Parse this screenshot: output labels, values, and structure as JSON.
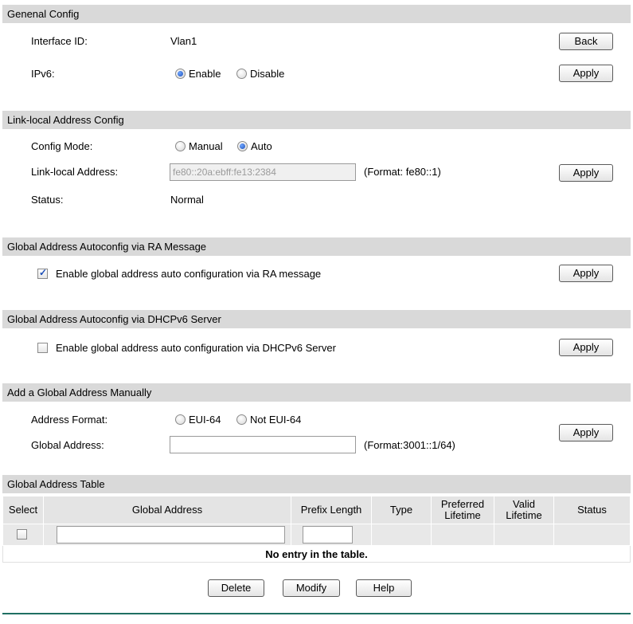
{
  "general": {
    "header": "Genenal Config",
    "interface_label": "Interface ID:",
    "interface_value": "Vlan1",
    "back_label": "Back",
    "ipv6_label": "IPv6:",
    "ipv6_options": [
      "Enable",
      "Disable"
    ],
    "ipv6_selected": "Enable",
    "apply_label": "Apply"
  },
  "link_local": {
    "header": "Link-local Address Config",
    "mode_label": "Config Mode:",
    "mode_options": [
      "Manual",
      "Auto"
    ],
    "mode_selected": "Auto",
    "address_label": "Link-local Address:",
    "address_value": "fe80::20a:ebff:fe13:2384",
    "address_format": "(Format: fe80::1)",
    "status_label": "Status:",
    "status_value": "Normal",
    "apply_label": "Apply"
  },
  "ra": {
    "header": "Global Address Autoconfig via RA Message",
    "checkbox_label": "Enable global address auto configuration via RA message",
    "checked": true,
    "apply_label": "Apply"
  },
  "dhcp": {
    "header": "Global Address Autoconfig via DHCPv6 Server",
    "checkbox_label": "Enable global address auto configuration via DHCPv6 Server",
    "checked": false,
    "apply_label": "Apply"
  },
  "manual": {
    "header": "Add a Global Address Manually",
    "format_label": "Address Format:",
    "format_options": [
      "EUI-64",
      "Not EUI-64"
    ],
    "format_selected": "",
    "address_label": "Global Address:",
    "address_value": "",
    "address_format": "(Format:3001::1/64)",
    "apply_label": "Apply"
  },
  "table": {
    "header": "Global Address Table",
    "columns": [
      "Select",
      "Global Address",
      "Prefix Length",
      "Type",
      "Preferred Lifetime",
      "Valid Lifetime",
      "Status"
    ],
    "empty_message": "No entry in the table."
  },
  "actions": {
    "delete_label": "Delete",
    "modify_label": "Modify",
    "help_label": "Help"
  }
}
